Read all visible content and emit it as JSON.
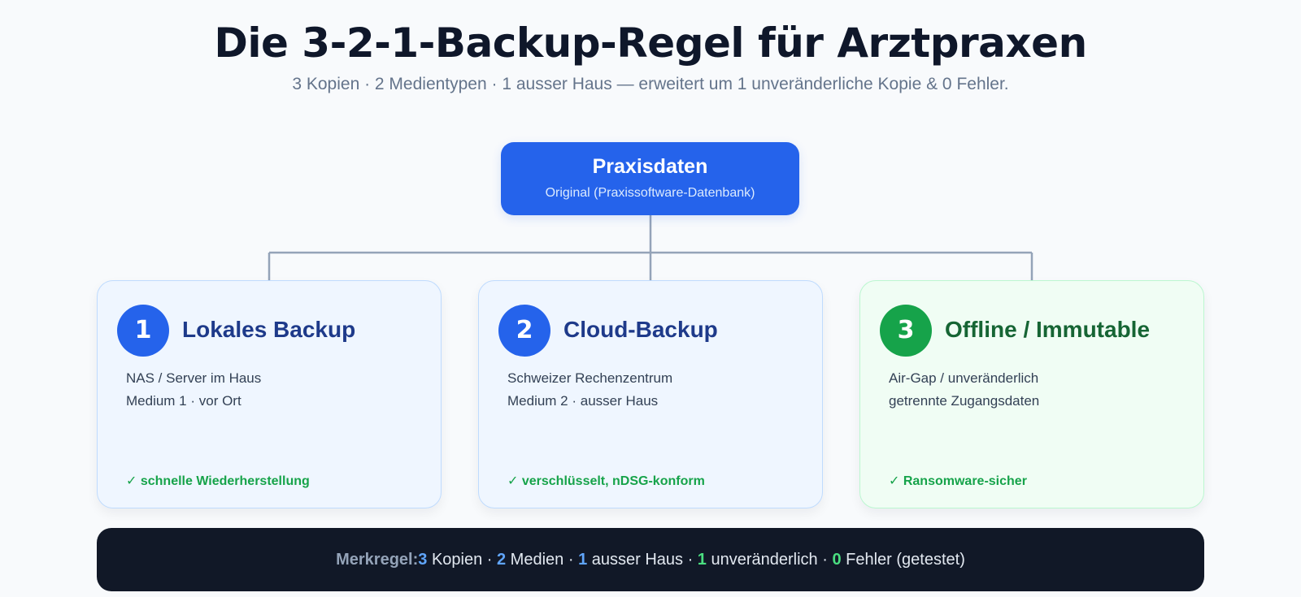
{
  "header": {
    "title": "Die 3-2-1-Backup-Regel für Arztpraxen",
    "subtitle": "3 Kopien · 2 Medientypen · 1 ausser Haus — erweitert um 1 unveränderliche Kopie & 0 Fehler."
  },
  "root": {
    "title": "Praxisdaten",
    "subtitle": "Original (Praxissoftware-Datenbank)"
  },
  "cards": [
    {
      "number": "1",
      "title": "Lokales Backup",
      "line1": "NAS / Server im Haus",
      "line2": "Medium 1 · vor Ort",
      "check": "✓ schnelle Wiederherstellung"
    },
    {
      "number": "2",
      "title": "Cloud-Backup",
      "line1": "Schweizer Rechenzentrum",
      "line2": "Medium 2 · ausser Haus",
      "check": "✓ verschlüsselt, nDSG-konform"
    },
    {
      "number": "3",
      "title": "Offline / Immutable",
      "line1": "Air-Gap / unveränderlich",
      "line2": "getrennte Zugangsdaten",
      "check": "✓ Ransomware-sicher"
    }
  ],
  "footer": {
    "label": "Merkregel:",
    "n1": "3",
    "t1": " Kopien · ",
    "n2": "2",
    "t2": " Medien · ",
    "n3": "1",
    "t3": " ausser Haus · ",
    "n4": "1",
    "t4": " unveränderlich · ",
    "n5": "0",
    "t5": " Fehler (getestet)"
  },
  "colors": {
    "primary_blue": "#2563eb",
    "green": "#16a34a",
    "connector": "#94a3b8",
    "footer_bg": "#111827"
  }
}
